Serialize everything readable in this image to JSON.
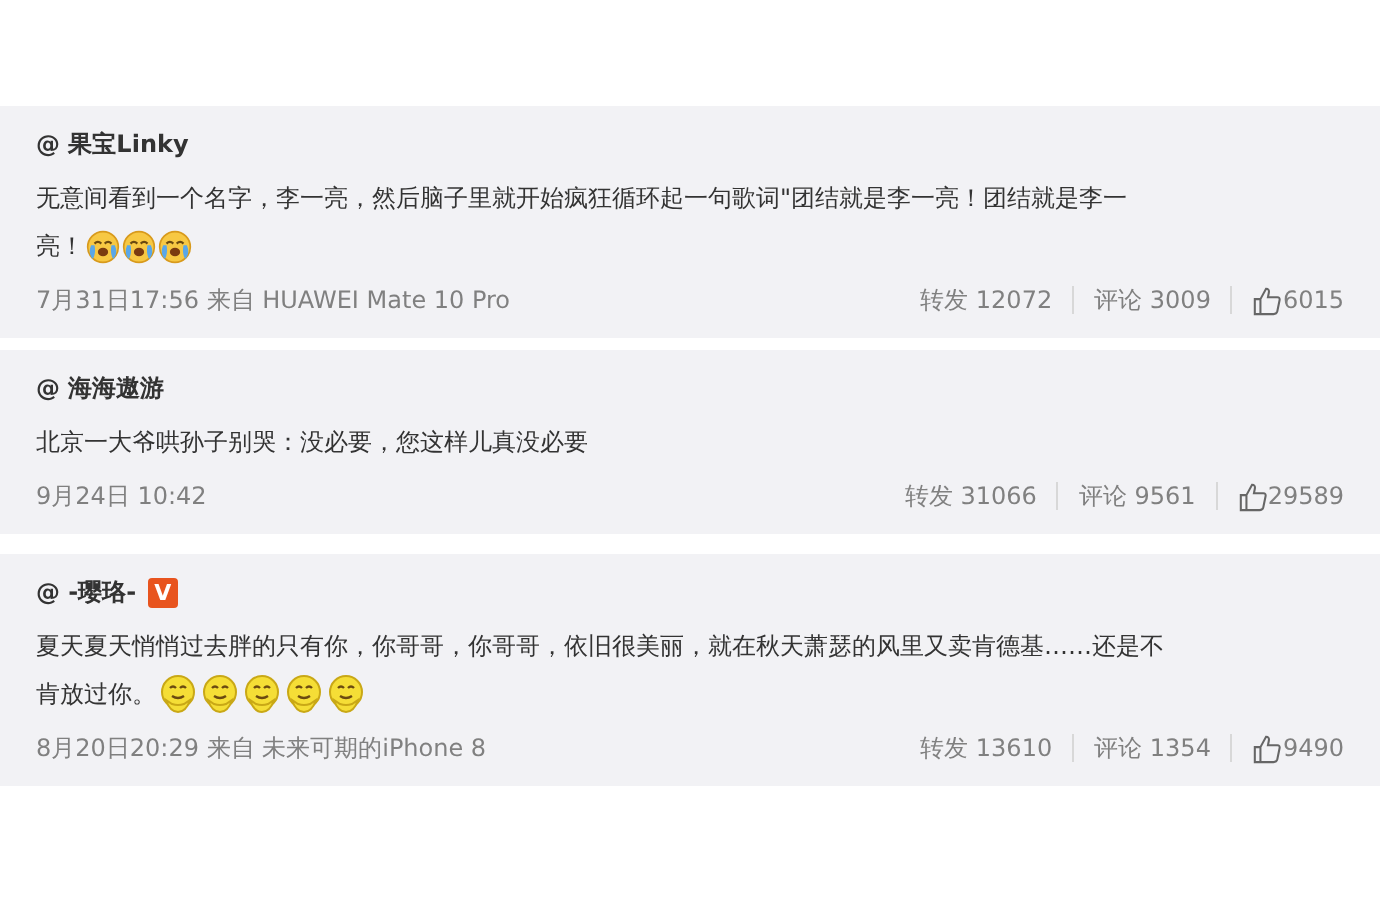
{
  "comments": [
    {
      "user": "@ 果宝Linky",
      "lines": [
        "无意间看到一个名字，李一亮，然后脑子里就开始疯狂循环起一句歌词\"团结就是李一亮！团结就是李一",
        "亮！"
      ],
      "emojis": [
        {
          "kind": "crying"
        },
        {
          "kind": "crying"
        },
        {
          "kind": "crying"
        }
      ],
      "meta": "7月31日17:56 来自 HUAWEI Mate 10 Pro",
      "reposts": "转发 12072",
      "comments": "评论 3009",
      "likes": "6015"
    },
    {
      "user": "@ 海海遨游",
      "lines": [
        "北京一大爷哄孙子别哭：没必要，您这样儿真没必要"
      ],
      "meta": "9月24日 10:42",
      "reposts": "转发 31066",
      "comments": "评论 9561",
      "likes": "29589"
    },
    {
      "user": "@ -璎珞-",
      "badge": "V",
      "lines": [
        "夏天夏天悄悄过去胖的只有你，你哥哥，你哥哥，依旧很美丽，就在秋天萧瑟的风里又卖肯德基……还是不",
        "肯放过你。"
      ],
      "emojis": [
        {
          "kind": "praying"
        },
        {
          "kind": "praying"
        },
        {
          "kind": "praying"
        },
        {
          "kind": "praying"
        },
        {
          "kind": "praying"
        }
      ],
      "meta": "8月20日20:29 来自 未来可期的iPhone 8",
      "reposts": "转发 13610",
      "comments": "评论 1354",
      "likes": "9490"
    }
  ]
}
